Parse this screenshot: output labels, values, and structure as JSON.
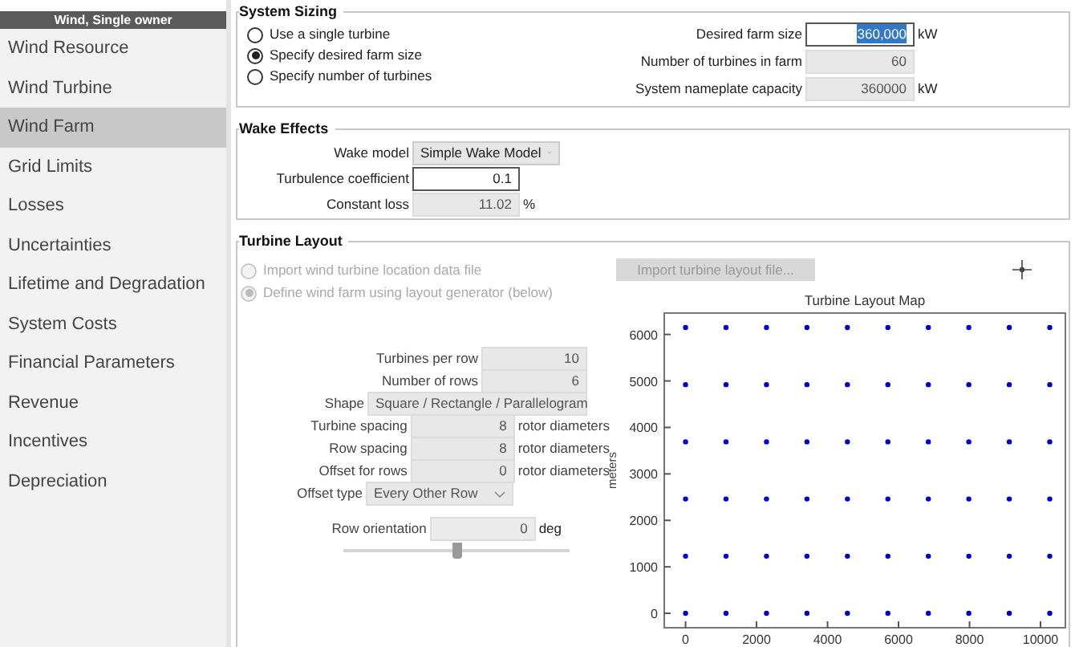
{
  "sidebar": {
    "header": "Wind, Single owner",
    "items": [
      {
        "label": "Wind Resource",
        "selected": false
      },
      {
        "label": "Wind Turbine",
        "selected": false
      },
      {
        "label": "Wind Farm",
        "selected": true
      },
      {
        "label": "Grid Limits",
        "selected": false
      },
      {
        "label": "Losses",
        "selected": false
      },
      {
        "label": "Uncertainties",
        "selected": false
      },
      {
        "label": "Lifetime and Degradation",
        "selected": false
      },
      {
        "label": "System Costs",
        "selected": false
      },
      {
        "label": "Financial Parameters",
        "selected": false
      },
      {
        "label": "Revenue",
        "selected": false
      },
      {
        "label": "Incentives",
        "selected": false
      },
      {
        "label": "Depreciation",
        "selected": false
      }
    ]
  },
  "system_sizing": {
    "title": "System Sizing",
    "options": [
      {
        "label": "Use a single turbine",
        "selected": false
      },
      {
        "label": "Specify desired farm size",
        "selected": true
      },
      {
        "label": "Specify number of turbines",
        "selected": false
      }
    ],
    "fields": [
      {
        "label": "Desired farm size",
        "value": "360,000",
        "unit": "kW",
        "disabled": false,
        "text_selected": true
      },
      {
        "label": "Number of turbines in farm",
        "value": "60",
        "disabled": true,
        "text_selected": false
      },
      {
        "label": "System nameplate capacity",
        "value": "360000",
        "unit": "kW",
        "disabled": true,
        "text_selected": false
      }
    ]
  },
  "wake_effects": {
    "title": "Wake Effects",
    "fields": [
      {
        "kind": "select",
        "label": "Wake model",
        "value": "Simple Wake Model",
        "disabled": false
      },
      {
        "kind": "input",
        "label": "Turbulence coefficient",
        "value": "0.1",
        "disabled": false
      },
      {
        "kind": "input",
        "label": "Constant loss",
        "value": "11.02",
        "unit": "%",
        "disabled": true
      }
    ]
  },
  "turbine_layout": {
    "title": "Turbine Layout",
    "options": [
      {
        "label": "Import wind turbine location data file",
        "selected": false,
        "disabled": true
      },
      {
        "label": "Define wind farm using layout generator (below)",
        "selected": true,
        "disabled": true
      }
    ],
    "import_button": {
      "label": "Import turbine layout file...",
      "disabled": true
    },
    "fields": [
      {
        "kind": "input",
        "label": "Turbines per row",
        "value": "10",
        "disabled": true
      },
      {
        "kind": "input",
        "label": "Number of rows",
        "value": "6",
        "disabled": true
      },
      {
        "kind": "select",
        "label": "Shape",
        "value": "Square / Rectangle / Parallelogram",
        "disabled": true
      },
      {
        "kind": "input",
        "label": "Turbine spacing",
        "value": "8",
        "unit": "rotor diameters",
        "disabled": true
      },
      {
        "kind": "input",
        "label": "Row spacing",
        "value": "8",
        "unit": "rotor diameters",
        "disabled": true
      },
      {
        "kind": "input",
        "label": "Offset for rows",
        "value": "0",
        "unit": "rotor diameters",
        "disabled": true
      },
      {
        "kind": "select",
        "label": "Offset type",
        "value": "Every Other Row",
        "disabled": true
      }
    ],
    "orientation": {
      "label": "Row orientation",
      "value": "0",
      "unit": "deg",
      "level": 0.5
    },
    "chart_data": {
      "type": "scatter",
      "title": "Turbine Layout Map",
      "ylabel": "meters",
      "x": [
        0,
        1140,
        2280,
        3420,
        4560,
        5700,
        6840,
        7980,
        9120,
        10260,
        0,
        1140,
        2280,
        3420,
        4560,
        5700,
        6840,
        7980,
        9120,
        10260,
        0,
        1140,
        2280,
        3420,
        4560,
        5700,
        6840,
        7980,
        9120,
        10260,
        0,
        1140,
        2280,
        3420,
        4560,
        5700,
        6840,
        7980,
        9120,
        10260,
        0,
        1140,
        2280,
        3420,
        4560,
        5700,
        6840,
        7980,
        9120,
        10260,
        0,
        1140,
        2280,
        3420,
        4560,
        5700,
        6840,
        7980,
        9120,
        10260
      ],
      "series": [
        {
          "color": "#0000cc",
          "values": [
            0,
            0,
            0,
            0,
            0,
            0,
            0,
            0,
            0,
            0,
            1230,
            1230,
            1230,
            1230,
            1230,
            1230,
            1230,
            1230,
            1230,
            1230,
            2460,
            2460,
            2460,
            2460,
            2460,
            2460,
            2460,
            2460,
            2460,
            2460,
            3690,
            3690,
            3690,
            3690,
            3690,
            3690,
            3690,
            3690,
            3690,
            3690,
            4920,
            4920,
            4920,
            4920,
            4920,
            4920,
            4920,
            4920,
            4920,
            4920,
            6150,
            6150,
            6150,
            6150,
            6150,
            6150,
            6150,
            6150,
            6150,
            6150
          ]
        }
      ],
      "xlim": [
        -600,
        10700
      ],
      "ylim": [
        -310,
        6460
      ],
      "xticks": [
        0,
        2000,
        4000,
        6000,
        8000,
        10000
      ],
      "yticks": [
        0,
        1000,
        2000,
        3000,
        4000,
        5000,
        6000
      ]
    }
  }
}
